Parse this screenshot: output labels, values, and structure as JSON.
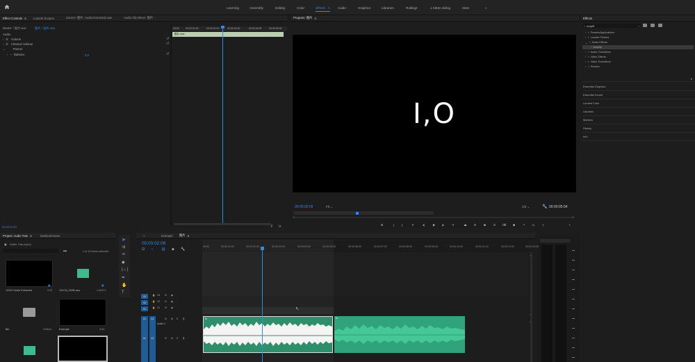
{
  "workspace": {
    "items": [
      "Learning",
      "Assembly",
      "Editing",
      "Color",
      "Effects",
      "Audio",
      "Graphics",
      "Libraries",
      "Rulling2",
      "1 Kitten olding",
      "Sites"
    ],
    "active": "Effects",
    "more": "»"
  },
  "effect_controls": {
    "tabs": [
      "Effect Controls",
      "Lumetri Scopes",
      "Source: 图片: Audio Extracted.wav",
      "Audio Clip Mixer: 图片"
    ],
    "source_label": "Master * 图片.wav",
    "clip_label": "图片 * 图片.wav",
    "section": "Audio",
    "rows": [
      "Volume",
      "Channel Volume",
      "Panner",
      "Balance"
    ],
    "balance_value": "0.0",
    "mini_timecodes": [
      "00:00",
      "00:00:01:00",
      "00:00:02:00",
      "00:00:03:00",
      "00:00:04:00",
      "00:00:05:00"
    ],
    "mini_clip": "图片.wav",
    "timecode": "00:00:02:09"
  },
  "program": {
    "tab": "Program: 图片",
    "text": "I,O",
    "timecode": "00:00:02:09",
    "fit": "Fit",
    "quality": "1/4",
    "duration": "00:00:05:04"
  },
  "effects_panel": {
    "title": "Effects",
    "search": "amplif",
    "tree": [
      "Presets/Applications",
      "Lumetri Presets",
      "Audio Effects",
      "Amplify",
      "Audio Transitions",
      "Video Effects",
      "Video Transitions",
      "Presets"
    ],
    "sections": [
      "Essential Graphics",
      "Essential Sound",
      "Lumetri Color",
      "Libraries",
      "Markers",
      "History",
      "Info"
    ]
  },
  "project": {
    "tabs": [
      "Project: Audio Tute",
      "Media Browser"
    ],
    "file": "Audio Tute.prproj",
    "items_count": "1 of 10 items selected",
    "items": [
      {
        "name": "13187 Audio Extracted",
        "meta": "0:22"
      },
      {
        "name": "131Clil_202B.wav",
        "meta": "1:40071"
      },
      {
        "name": "Bin",
        "meta": "3 items"
      },
      {
        "name": "Example",
        "meta": "4:04"
      }
    ]
  },
  "timeline": {
    "tabs": [
      "Example",
      "图片"
    ],
    "timecode": "00:00:02:09",
    "ruler": [
      "00:00",
      "00:00:01:00",
      "00:00:02:00",
      "00:00:03:00",
      "00:00:04:00",
      "00:00:05:00",
      "00:00:06:00",
      "00:00:07:00",
      "00:00:08:00",
      "00:00:09:00",
      "00:00:10:00",
      "00:00:11:00",
      "00:00:12:00",
      "00:00:13:00"
    ],
    "video_tracks": [
      "V3",
      "V2",
      "V1"
    ],
    "audio_tracks": [
      "A1",
      "A2"
    ],
    "audio_track_name": "Audio 1",
    "clip_badge": "fx"
  },
  "colors": {
    "accent": "#2d8ceb",
    "audio_clip": "#2fa37c",
    "audio_clip_selected": "#2f8f6c"
  }
}
